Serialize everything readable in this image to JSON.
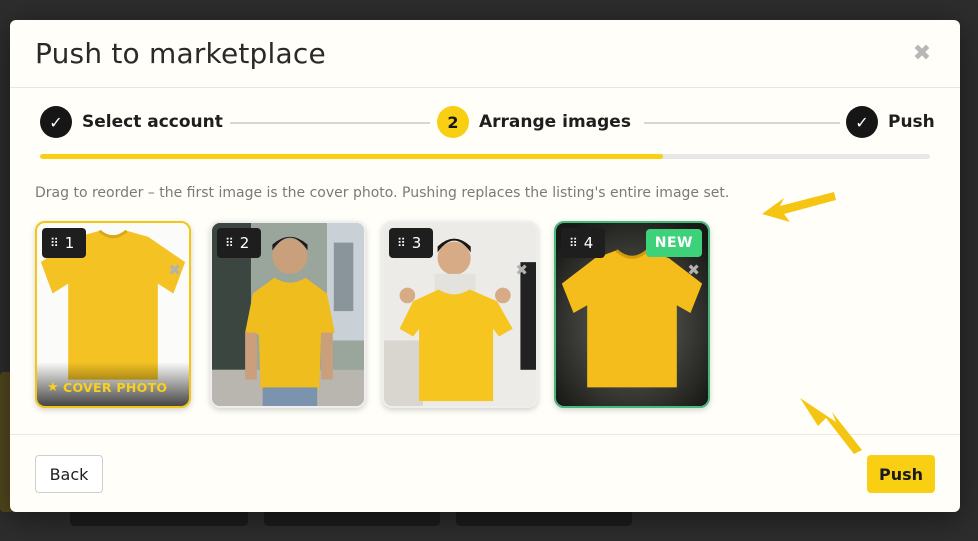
{
  "modal": {
    "title": "Push to marketplace",
    "close_icon": "close-icon"
  },
  "stepper": {
    "steps": [
      {
        "label": "Select account",
        "state": "done",
        "marker": "✓"
      },
      {
        "label": "Arrange images",
        "state": "active",
        "marker": "2"
      },
      {
        "label": "Push",
        "state": "done",
        "marker": "✓"
      }
    ],
    "progress_fraction": 0.7
  },
  "hint": "Drag to reorder – the first image is the cover photo. Pushing replaces the listing's entire image set.",
  "images": [
    {
      "index": "1",
      "cover_label": "COVER PHOTO",
      "star": "★",
      "remove": "✖"
    },
    {
      "index": "2"
    },
    {
      "index": "3",
      "remove": "✖"
    },
    {
      "index": "4",
      "new_label": "NEW",
      "remove": "✖"
    }
  ],
  "grip": "⠿",
  "footer": {
    "back_label": "Back",
    "push_label": "Push"
  },
  "colors": {
    "accent": "#f8cf13",
    "dark": "#161616",
    "new_green": "#3dd17a"
  }
}
